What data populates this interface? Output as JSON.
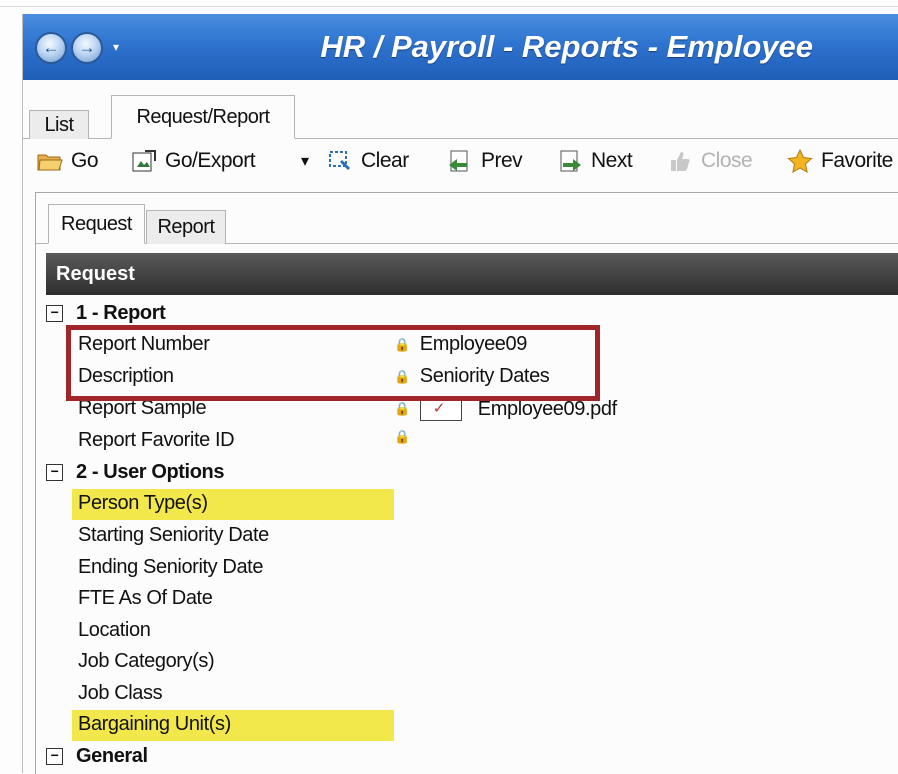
{
  "window": {
    "title": "HR / Payroll - Reports - Employee",
    "nav_back_glyph": "←",
    "nav_forward_glyph": "→",
    "nav_dropdown_glyph": "▾"
  },
  "outer_tabs": [
    {
      "label": "List",
      "active": false
    },
    {
      "label": "Request/Report",
      "active": true
    }
  ],
  "toolbar": {
    "go": {
      "label": "Go",
      "icon": "folder-open-icon"
    },
    "go_export": {
      "label": "Go/Export",
      "icon": "export-icon"
    },
    "dropdown_glyph": "▾",
    "clear": {
      "label": "Clear",
      "icon": "clear-icon"
    },
    "prev": {
      "label": "Prev",
      "icon": "prev-icon"
    },
    "next": {
      "label": "Next",
      "icon": "next-icon"
    },
    "close": {
      "label": "Close",
      "icon": "thumbs-up-icon",
      "disabled": true
    },
    "favorites": {
      "label": "Favorite",
      "icon": "star-icon"
    }
  },
  "inner_tabs": [
    {
      "label": "Request",
      "active": true
    },
    {
      "label": "Report",
      "active": false
    }
  ],
  "grid": {
    "header": "Request",
    "sections": {
      "report": {
        "title": "1 - Report",
        "toggle": "−",
        "rows": {
          "report_number": {
            "label": "Report Number",
            "value": "Employee09"
          },
          "description": {
            "label": "Description",
            "value": "Seniority Dates"
          },
          "report_sample": {
            "label": "Report Sample",
            "value": "Employee09.pdf"
          },
          "report_favorite_id": {
            "label": "Report Favorite ID",
            "value": ""
          }
        }
      },
      "user_options": {
        "title": "2 - User Options",
        "toggle": "−",
        "rows": {
          "person_types": {
            "label": "Person Type(s)",
            "highlighted": true
          },
          "starting_seniority_date": {
            "label": "Starting Seniority Date"
          },
          "ending_seniority_date": {
            "label": "Ending Seniority Date"
          },
          "fte_as_of_date": {
            "label": "FTE As Of Date"
          },
          "location": {
            "label": "Location"
          },
          "job_categories": {
            "label": "Job Category(s)"
          },
          "job_class": {
            "label": "Job Class"
          },
          "bargaining_units": {
            "label": "Bargaining Unit(s)",
            "highlighted": true
          }
        }
      },
      "general": {
        "title": "General",
        "toggle": "−"
      }
    }
  },
  "colors": {
    "title_bar": "#2e73cf",
    "grid_header": "#3a3a3a",
    "highlight": "#f2e84c",
    "annotation_box": "#a0262a"
  },
  "icons": {
    "lock": "🔒",
    "pdf_mark": "✓"
  }
}
